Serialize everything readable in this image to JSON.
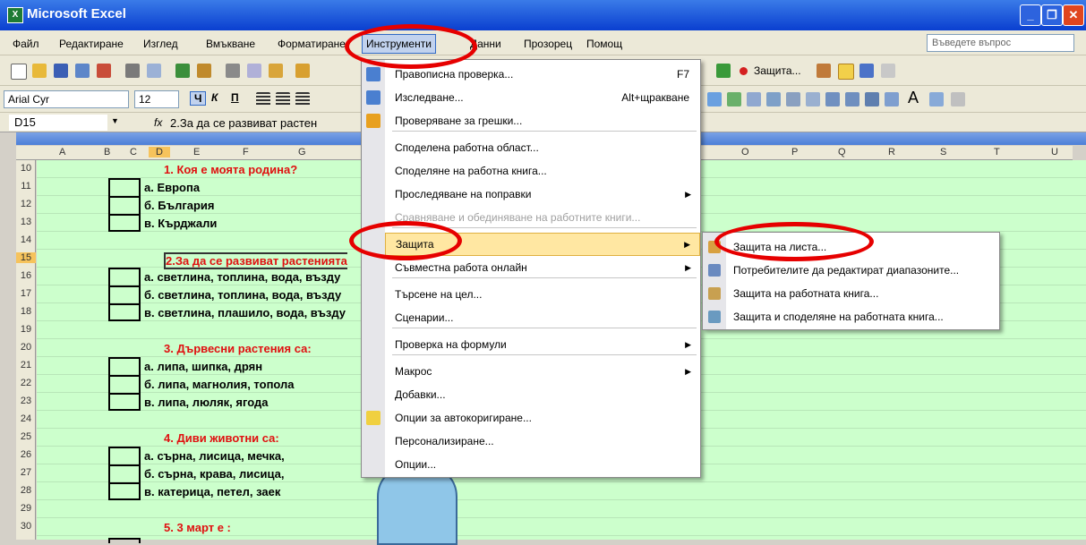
{
  "window": {
    "title": "Microsoft Excel",
    "app_icon": "excel-icon"
  },
  "menubar": {
    "items": [
      "Файл",
      "Редактиране",
      "Изглед",
      "Вмъкване",
      "Форматиране",
      "Инструменти",
      "Данни",
      "Прозорец",
      "Помощ"
    ],
    "ask_placeholder": "Въведете въпрос"
  },
  "toolbar": {
    "font": "Arial Cyr",
    "size": "12",
    "protect_label": "Защита...",
    "bold": "Ч",
    "italic": "К",
    "underline": "П",
    "letter_a": "A"
  },
  "formula_bar": {
    "cell": "D15",
    "fx": "fx",
    "content": "2.За да се развиват растен"
  },
  "sheet": {
    "columns": [
      "A",
      "B",
      "C",
      "D",
      "E",
      "F",
      "G",
      "O",
      "P",
      "Q",
      "R",
      "S",
      "T",
      "U"
    ],
    "rows": [
      "10",
      "11",
      "12",
      "13",
      "14",
      "15",
      "16",
      "17",
      "18",
      "19",
      "20",
      "21",
      "22",
      "23",
      "24",
      "25",
      "26",
      "27",
      "28",
      "29",
      "30"
    ],
    "active_row": "15",
    "questions": [
      {
        "q": "1. Коя е моята родина?",
        "answers": [
          "а. Европа",
          "б. България",
          "в. Кърджали"
        ]
      },
      {
        "q": "2.За да се развиват растенията",
        "answers": [
          "а. светлина, топлина, вода, възду",
          "б. светлина, топлина, вода, възду",
          "в. светлина, плашило, вода, възду"
        ]
      },
      {
        "q": "3. Дървесни растения са:",
        "answers": [
          "а. липа, шипка, дрян",
          "б. липа, магнолия, топола",
          "в. липа, люляк, ягода"
        ]
      },
      {
        "q": "4. Диви животни са:",
        "answers": [
          "а. сърна, лисица, мечка,",
          "б. сърна, крава, лисица,",
          "в. катерица, петел, заек"
        ]
      },
      {
        "q": "5. 3 март е :",
        "answers": []
      }
    ]
  },
  "tools_menu": {
    "items": [
      {
        "label": "Правописна проверка...",
        "shortcut": "F7"
      },
      {
        "label": "Изследване...",
        "shortcut": "Alt+щракване"
      },
      {
        "label": "Проверяване за грешки..."
      },
      {
        "label": "Споделена работна област..."
      },
      {
        "label": "Споделяне на работна книга..."
      },
      {
        "label": "Проследяване на поправки"
      },
      {
        "label": "Сравняване и обединяване на работните книги..."
      },
      {
        "label": "Защита"
      },
      {
        "label": "Съвместна работа онлайн"
      },
      {
        "label": "Търсене на цел..."
      },
      {
        "label": "Сценарии..."
      },
      {
        "label": "Проверка на формули"
      },
      {
        "label": "Макрос"
      },
      {
        "label": "Добавки..."
      },
      {
        "label": "Опции за автокоригиране..."
      },
      {
        "label": "Персонализиране..."
      },
      {
        "label": "Опции..."
      }
    ]
  },
  "protect_submenu": {
    "items": [
      "Защита на листа...",
      "Потребителите да редактират диапазоните...",
      "Защита на работната книга...",
      "Защита и споделяне на работната книга..."
    ]
  },
  "colors": {
    "sheet_bg": "#ccffcc",
    "question_red": "#e01010",
    "highlight": "#ffe7a2",
    "oval_red": "#e60000"
  }
}
